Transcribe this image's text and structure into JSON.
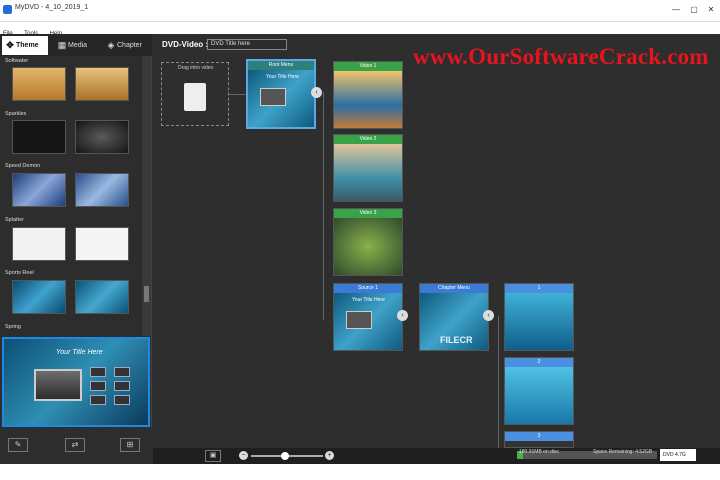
{
  "window": {
    "title": "MyDVD - 4_10_2019_1",
    "controls": [
      "—",
      "▢",
      "✕"
    ]
  },
  "menu": [
    "File",
    "Tools",
    "Help"
  ],
  "tabs": [
    {
      "label": "Theme",
      "icon": "theme-icon"
    },
    {
      "label": "Media",
      "icon": "film-icon"
    },
    {
      "label": "Chapter",
      "icon": "layers-icon"
    }
  ],
  "theme_groups": [
    {
      "label": "Softwater"
    },
    {
      "label": "Sparkles"
    },
    {
      "label": "Speed Demon"
    },
    {
      "label": "Splatter"
    },
    {
      "label": "Sports Reel"
    },
    {
      "label": "Spring"
    }
  ],
  "preview": {
    "title": "Your Title Here"
  },
  "main": {
    "dvd_label": "DVD-Video :",
    "dvd_title": "DVD Title here",
    "watermark": "www.OurSoftwareCrack.com",
    "intro_label": "Drag intro video",
    "root_menu": {
      "title": "Root Menu",
      "subtitle": "Your Title Here"
    },
    "videos": [
      "Video 1",
      "Video 2",
      "Video 3"
    ],
    "source": {
      "title": "Source 1",
      "subtitle": "Your Title Here"
    },
    "chapter_menu": {
      "title": "Chapter Menu",
      "watermark": "FILECR"
    },
    "chapters": [
      "1",
      "2",
      "3"
    ]
  },
  "status": {
    "used": "180.91MB on disc",
    "remaining": "Space Remaining: 4.52GB",
    "disc": "DVD 4.7G",
    "disc_fill_fraction": 0.04
  }
}
